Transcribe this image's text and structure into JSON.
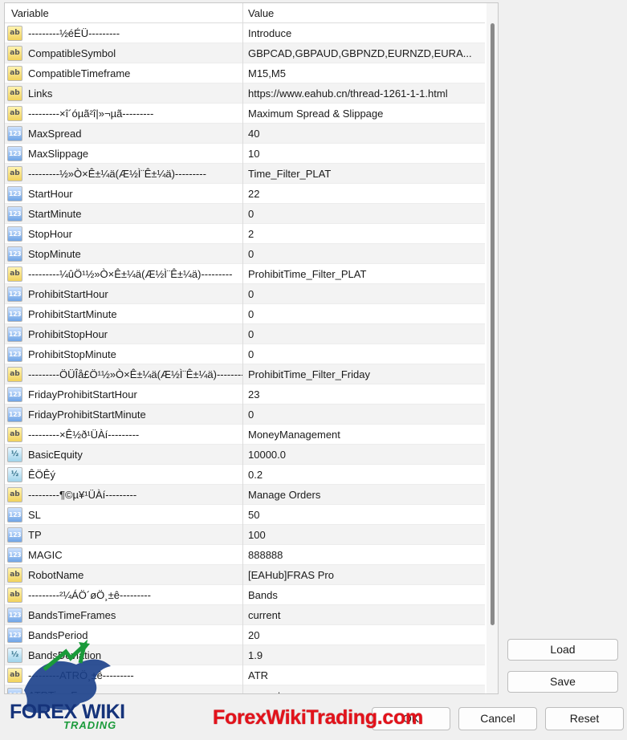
{
  "header": {
    "variable": "Variable",
    "value": "Value"
  },
  "rows": [
    {
      "type": "ab",
      "name": "---------½éÉÜ---------",
      "value": "Introduce"
    },
    {
      "type": "ab",
      "name": "CompatibleSymbol",
      "value": "GBPCAD,GBPAUD,GBPNZD,EURNZD,EURA..."
    },
    {
      "type": "ab",
      "name": "CompatibleTimeframe",
      "value": "M15,M5"
    },
    {
      "type": "ab",
      "name": "Links",
      "value": "https://www.eahub.cn/thread-1261-1-1.html"
    },
    {
      "type": "ab",
      "name": "---------×î´óµã²î|»¬µã---------",
      "value": "Maximum Spread & Slippage"
    },
    {
      "type": "123",
      "name": "MaxSpread",
      "value": "40"
    },
    {
      "type": "123",
      "name": "MaxSlippage",
      "value": "10"
    },
    {
      "type": "ab",
      "name": "---------½»Ò×Ê±¼ä(Æ½Ì¨Ê±¼ä)---------",
      "value": "Time_Filter_PLAT"
    },
    {
      "type": "123",
      "name": "StartHour",
      "value": "22"
    },
    {
      "type": "123",
      "name": "StartMinute",
      "value": "0"
    },
    {
      "type": "123",
      "name": "StopHour",
      "value": "2"
    },
    {
      "type": "123",
      "name": "StopMinute",
      "value": "0"
    },
    {
      "type": "ab",
      "name": "---------¼ûÖ¹½»Ò×Ê±¼ä(Æ½Ì¨Ê±¼ä)---------",
      "value": "ProhibitTime_Filter_PLAT"
    },
    {
      "type": "123",
      "name": "ProhibitStartHour",
      "value": "0"
    },
    {
      "type": "123",
      "name": "ProhibitStartMinute",
      "value": "0"
    },
    {
      "type": "123",
      "name": "ProhibitStopHour",
      "value": "0"
    },
    {
      "type": "123",
      "name": "ProhibitStopMinute",
      "value": "0"
    },
    {
      "type": "ab",
      "name": "---------ÖÜÎå£Ö¹½»Ò×Ê±¼ä(Æ½Ì¨Ê±¼ä)---------",
      "value": "ProhibitTime_Filter_Friday"
    },
    {
      "type": "123",
      "name": "FridayProhibitStartHour",
      "value": "23"
    },
    {
      "type": "123",
      "name": "FridayProhibitStartMinute",
      "value": "0"
    },
    {
      "type": "ab",
      "name": "---------×Ê½ð¹ÜÀí---------",
      "value": "MoneyManagement"
    },
    {
      "type": "dbl",
      "name": "BasicEquity",
      "value": "10000.0"
    },
    {
      "type": "dbl",
      "name": "ÊÖÊý",
      "value": "0.2"
    },
    {
      "type": "ab",
      "name": "---------¶©µ¥¹ÜÀí---------",
      "value": "Manage Orders"
    },
    {
      "type": "123",
      "name": "SL",
      "value": "50"
    },
    {
      "type": "123",
      "name": "TP",
      "value": "100"
    },
    {
      "type": "123",
      "name": "MAGIC",
      "value": "888888"
    },
    {
      "type": "ab",
      "name": "RobotName",
      "value": "[EAHub]FRAS Pro"
    },
    {
      "type": "ab",
      "name": "---------²¼ÁÖ´øÖ¸±ê---------",
      "value": "Bands"
    },
    {
      "type": "123",
      "name": "BandsTimeFrames",
      "value": "current"
    },
    {
      "type": "123",
      "name": "BandsPeriod",
      "value": "20"
    },
    {
      "type": "dbl",
      "name": "BandsDeviation",
      "value": "1.9"
    },
    {
      "type": "ab",
      "name": "---------ATRÖ¸±ê---------",
      "value": "ATR"
    },
    {
      "type": "123",
      "name": "ATRTimeFrames",
      "value": "current"
    }
  ],
  "type_icons": {
    "ab": "ab",
    "123": "123",
    "dbl": "½"
  },
  "buttons": {
    "load": "Load",
    "save": "Save",
    "ok": "OK",
    "cancel": "Cancel",
    "reset": "Reset"
  },
  "branding": {
    "logo_main": "FOREX WIKI",
    "logo_sub": "TRADING",
    "watermark": "ForexWikiTrading.com"
  },
  "colors": {
    "logo_blue": "#15337a",
    "logo_green": "#1a9a3a",
    "watermark_red": "#e3121b"
  }
}
